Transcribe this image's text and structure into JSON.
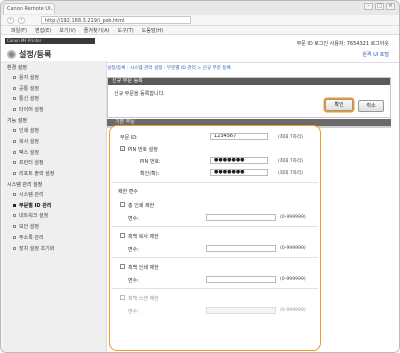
{
  "browser": {
    "tab_title": "Canon Remote UI...",
    "url": "http://192.168.3.219/i_psb.html",
    "menu": [
      "파일(F)",
      "편집(E)",
      "보기(V)",
      "즐겨찾기(A)",
      "도구(T)",
      "도움말(H)"
    ],
    "controls": {
      "back": "‹",
      "forward": "›",
      "minimize": "–",
      "maximize": "□",
      "close": "×"
    }
  },
  "header": {
    "product_name": "Canon MF Printer",
    "title": "설정/등록",
    "user_info": "부문 ID   로그인 사용자: 7654321   로그아웃",
    "portal_link": "원격 UI 포털"
  },
  "sidebar": {
    "sections": [
      {
        "title": "환경 설정",
        "items": [
          "용지 설정",
          "공통 설정",
          "통신 설정",
          "타이머 설정"
        ]
      },
      {
        "title": "기능 설정",
        "items": [
          "인쇄 설정",
          "복사 설정",
          "팩스 설정",
          "프린터 설정",
          "리포트 출력 설정"
        ]
      },
      {
        "title": "시스템 관리 설정",
        "items": [
          "시스템 관리",
          "부문별 ID 관리",
          "네트워크 설정",
          "보안 설정",
          "주소록 관리",
          "장치 설정 초기화"
        ]
      }
    ],
    "active_item": "부문별 ID 관리"
  },
  "main": {
    "breadcrumb": "설정/등록 : 시스템 관리 설정 : 부문별 ID 관리 > 신규 부문 등록",
    "panel_title": "신규 부문 등록",
    "panel_message": "신규 부문을 등록합니다.",
    "ok_label": "확인",
    "cancel_label": "취소",
    "tab_label": "기본 부문",
    "dept_id_label": "부문 ID:",
    "dept_id_value": "1234567",
    "dept_id_hint": "(최대 7자리)",
    "pin_checkbox_label": "PIN 번호 설정",
    "pin_checked": true,
    "pin_label": "PIN 번호:",
    "pin_value": "●●●●●●●",
    "pin_hint": "(최대 7자리)",
    "confirm_label": "확인(확):",
    "confirm_value": "●●●●●●●",
    "confirm_hint": "(최대 7자리)",
    "limits_title": "제한 면수",
    "limits": [
      {
        "label": "총 인쇄 제한",
        "count_label": "면수:",
        "range": "(0-999999)",
        "disabled": false
      },
      {
        "label": "흑백 복사 제한",
        "count_label": "면수:",
        "range": "(0-999999)",
        "disabled": false
      },
      {
        "label": "흑백 인쇄 제한",
        "count_label": "면수:",
        "range": "(0-999999)",
        "disabled": false
      },
      {
        "label": "흑백 스캔 제한",
        "count_label": "면수:",
        "range": "(0-999999)",
        "disabled": true
      }
    ]
  }
}
